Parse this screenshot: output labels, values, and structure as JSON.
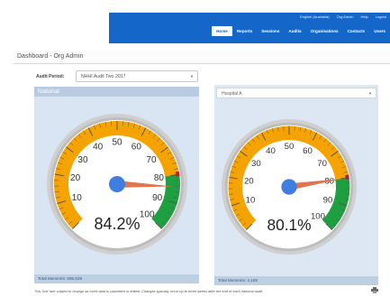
{
  "header": {
    "utility_links": [
      "English (Australia)",
      "Org Admin",
      "Help",
      "Logout"
    ],
    "nav_tabs": [
      "Home",
      "Reports",
      "Sessions",
      "Audits",
      "Organisations",
      "Contacts",
      "Users"
    ],
    "active_tab": "Home"
  },
  "page": {
    "title": "Dashboard - Org Admin"
  },
  "audit_period": {
    "label": "Audit Period:",
    "value": "NHHI Audit Two 2017"
  },
  "gauges": [
    {
      "panel_title": "National",
      "value_text": "84.2%",
      "value": 84.2,
      "footer": "Total Moments: 596,639"
    },
    {
      "panel_title": "Hospital A",
      "value_text": "80.1%",
      "value": 80.1,
      "footer": "Total Moments: 4,105"
    }
  ],
  "gauge_scale": {
    "min": 0,
    "max": 100,
    "ticks": [
      "10",
      "20",
      "30",
      "40",
      "50",
      "60",
      "70",
      "80",
      "90",
      "100"
    ]
  },
  "colors": {
    "nav": "#1466c8",
    "orange_band": "#f5a300",
    "green_band": "#1fa040",
    "red_band": "#c8102e",
    "needle": "#e07650",
    "hub": "#3f7de0"
  },
  "footnote": "This 'live' rate subject to change as more data is submitted or edited. Changes typically occur up to three weeks after the end of each national audit.",
  "icons": {
    "print": "print-icon"
  }
}
